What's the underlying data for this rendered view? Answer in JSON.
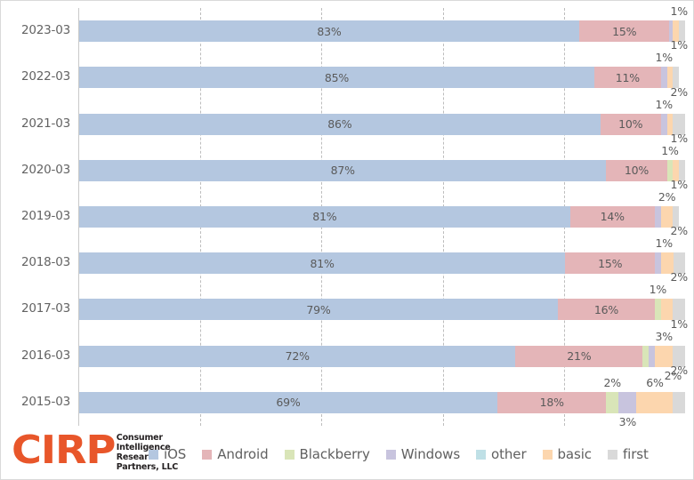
{
  "chart_data": {
    "type": "bar",
    "orientation": "horizontal",
    "stacked": true,
    "normalized_percent": true,
    "title": "",
    "subtitle": "",
    "xlabel": "",
    "ylabel": "",
    "xlim": [
      0,
      100
    ],
    "grid": "vertical dashed gridlines at 20, 40, 60, 80",
    "gridline_values": [
      20,
      40,
      60,
      80
    ],
    "legend_position": "bottom",
    "categories": [
      "2023-03",
      "2022-03",
      "2021-03",
      "2020-03",
      "2019-03",
      "2018-03",
      "2017-03",
      "2016-03",
      "2015-03"
    ],
    "series": [
      {
        "name": "iOS",
        "color": "#b4c7e0",
        "values": [
          83,
          85,
          86,
          87,
          81,
          81,
          79,
          72,
          69
        ]
      },
      {
        "name": "Android",
        "color": "#e4b5b8",
        "values": [
          15,
          11,
          10,
          10,
          14,
          15,
          16,
          21,
          18
        ]
      },
      {
        "name": "Blackberry",
        "color": "#d9e5b8",
        "values": [
          0,
          0,
          0,
          1,
          0,
          0,
          1,
          1,
          2
        ]
      },
      {
        "name": "Windows",
        "color": "#c8c4de",
        "values": [
          0,
          1,
          1,
          0,
          1,
          1,
          0,
          1,
          3
        ]
      },
      {
        "name": "other",
        "color": "#bfe0e6",
        "values": [
          0,
          0,
          0,
          0,
          0,
          0,
          0,
          0,
          0
        ]
      },
      {
        "name": "basic",
        "color": "#fcd6ae",
        "values": [
          1,
          1,
          1,
          1,
          2,
          2,
          2,
          3,
          6
        ]
      },
      {
        "name": "first",
        "color": "#d9d9d9",
        "values": [
          1,
          1,
          2,
          1,
          1,
          2,
          2,
          2,
          2
        ]
      }
    ]
  },
  "rows": [
    {
      "category": "2023-03",
      "segments": [
        {
          "series": "iOS",
          "value": 83,
          "label": "83%",
          "label_mode": "inside"
        },
        {
          "series": "Android",
          "value": 15,
          "label": "15%",
          "label_mode": "inside"
        },
        {
          "series": "Windows",
          "value": 0.6,
          "label": "",
          "label_mode": "none"
        },
        {
          "series": "basic",
          "value": 1,
          "label": "",
          "label_mode": "none"
        },
        {
          "series": "first",
          "value": 1,
          "label": "1%",
          "label_mode": "above"
        }
      ]
    },
    {
      "category": "2022-03",
      "segments": [
        {
          "series": "iOS",
          "value": 85,
          "label": "85%",
          "label_mode": "inside"
        },
        {
          "series": "Android",
          "value": 11,
          "label": "11%",
          "label_mode": "inside"
        },
        {
          "series": "Windows",
          "value": 1,
          "label": "1%",
          "label_mode": "above"
        },
        {
          "series": "basic",
          "value": 1,
          "label": "",
          "label_mode": "none"
        },
        {
          "series": "first",
          "value": 1,
          "label": "1%",
          "label_mode": "above-high"
        }
      ]
    },
    {
      "category": "2021-03",
      "segments": [
        {
          "series": "iOS",
          "value": 86,
          "label": "86%",
          "label_mode": "inside"
        },
        {
          "series": "Android",
          "value": 10,
          "label": "10%",
          "label_mode": "inside"
        },
        {
          "series": "Windows",
          "value": 1,
          "label": "1%",
          "label_mode": "above"
        },
        {
          "series": "basic",
          "value": 1,
          "label": "",
          "label_mode": "none"
        },
        {
          "series": "first",
          "value": 2,
          "label": "2%",
          "label_mode": "above-high"
        }
      ]
    },
    {
      "category": "2020-03",
      "segments": [
        {
          "series": "iOS",
          "value": 87,
          "label": "87%",
          "label_mode": "inside"
        },
        {
          "series": "Android",
          "value": 10,
          "label": "10%",
          "label_mode": "inside"
        },
        {
          "series": "Blackberry",
          "value": 1,
          "label": "1%",
          "label_mode": "above"
        },
        {
          "series": "basic",
          "value": 1,
          "label": "",
          "label_mode": "none"
        },
        {
          "series": "first",
          "value": 1,
          "label": "1%",
          "label_mode": "above-high"
        }
      ]
    },
    {
      "category": "2019-03",
      "segments": [
        {
          "series": "iOS",
          "value": 81,
          "label": "81%",
          "label_mode": "inside"
        },
        {
          "series": "Android",
          "value": 14,
          "label": "14%",
          "label_mode": "inside"
        },
        {
          "series": "Windows",
          "value": 1,
          "label": "",
          "label_mode": "none"
        },
        {
          "series": "basic",
          "value": 2,
          "label": "2%",
          "label_mode": "above"
        },
        {
          "series": "first",
          "value": 1,
          "label": "1%",
          "label_mode": "above-high"
        }
      ]
    },
    {
      "category": "2018-03",
      "segments": [
        {
          "series": "iOS",
          "value": 81,
          "label": "81%",
          "label_mode": "inside"
        },
        {
          "series": "Android",
          "value": 15,
          "label": "15%",
          "label_mode": "inside"
        },
        {
          "series": "Windows",
          "value": 1,
          "label": "1%",
          "label_mode": "above"
        },
        {
          "series": "basic",
          "value": 2,
          "label": "",
          "label_mode": "none"
        },
        {
          "series": "first",
          "value": 2,
          "label": "2%",
          "label_mode": "above-high"
        }
      ]
    },
    {
      "category": "2017-03",
      "segments": [
        {
          "series": "iOS",
          "value": 79,
          "label": "79%",
          "label_mode": "inside"
        },
        {
          "series": "Android",
          "value": 16,
          "label": "16%",
          "label_mode": "inside"
        },
        {
          "series": "Blackberry",
          "value": 1,
          "label": "1%",
          "label_mode": "above"
        },
        {
          "series": "basic",
          "value": 2,
          "label": "",
          "label_mode": "none"
        },
        {
          "series": "first",
          "value": 2,
          "label": "2%",
          "label_mode": "above-high"
        }
      ]
    },
    {
      "category": "2016-03",
      "segments": [
        {
          "series": "iOS",
          "value": 72,
          "label": "72%",
          "label_mode": "inside"
        },
        {
          "series": "Android",
          "value": 21,
          "label": "21%",
          "label_mode": "inside"
        },
        {
          "series": "Blackberry",
          "value": 1,
          "label": "",
          "label_mode": "none"
        },
        {
          "series": "Windows",
          "value": 1,
          "label": "",
          "label_mode": "none"
        },
        {
          "series": "basic",
          "value": 3,
          "label": "3%",
          "label_mode": "above"
        },
        {
          "series": "first",
          "value": 2,
          "label": "1%",
          "label_mode": "above-high"
        }
      ]
    },
    {
      "category": "2015-03",
      "segments": [
        {
          "series": "iOS",
          "value": 69,
          "label": "69%",
          "label_mode": "inside"
        },
        {
          "series": "Android",
          "value": 18,
          "label": "18%",
          "label_mode": "inside"
        },
        {
          "series": "Blackberry",
          "value": 2,
          "label": "2%",
          "label_mode": "above"
        },
        {
          "series": "Windows",
          "value": 3,
          "label": "3%",
          "label_mode": "below"
        },
        {
          "series": "basic",
          "value": 6,
          "label": "6%",
          "label_mode": "above"
        },
        {
          "series": "first",
          "value": 2,
          "label": "2%",
          "label_mode": "above-high"
        }
      ]
    }
  ],
  "extra_callouts": [
    {
      "row": "2016-03",
      "label": "2%",
      "x_pct": 98,
      "position": "below"
    }
  ],
  "legend": {
    "items": [
      {
        "label": "iOS",
        "color": "#b4c7e0"
      },
      {
        "label": "Android",
        "color": "#e4b5b8"
      },
      {
        "label": "Blackberry",
        "color": "#d9e5b8"
      },
      {
        "label": "Windows",
        "color": "#c8c4de"
      },
      {
        "label": "other",
        "color": "#bfe0e6"
      },
      {
        "label": "basic",
        "color": "#fcd6ae"
      },
      {
        "label": "first",
        "color": "#d9d9d9"
      }
    ]
  },
  "logo": {
    "mark": "CIRP",
    "lines": [
      "Consumer",
      "Intelligence",
      "Research",
      "Partners, LLC"
    ],
    "color": "#E8562A"
  }
}
